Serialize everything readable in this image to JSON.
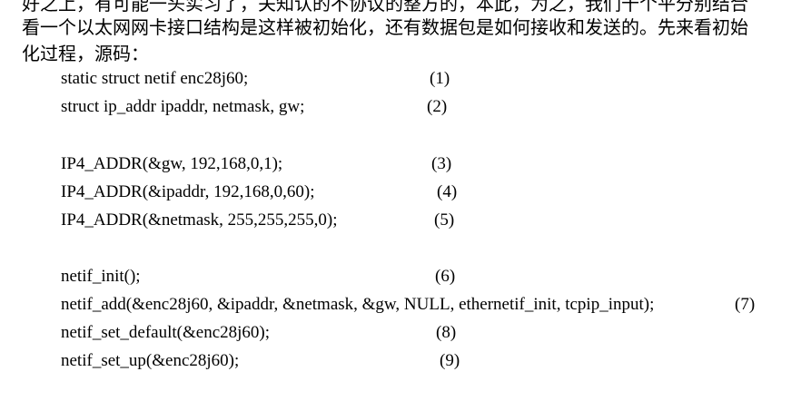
{
  "intro": {
    "cut_line": "好之上，有可能一头实习了，关知认的不协议的整方的，本此，为之，我们十个平分别结合",
    "line1": "看一个以太网网卡接口结构是这样被初始化，还有数据包是如何接收和发送的。先来看初始",
    "line2": "化过程，源码："
  },
  "code": [
    {
      "text": "static struct netif enc28j60;",
      "num": "(1)"
    },
    {
      "text": "struct ip_addr ipaddr, netmask, gw;",
      "num": "(2)"
    },
    {
      "text": "IP4_ADDR(&gw, 192,168,0,1);",
      "num": "(3)"
    },
    {
      "text": "IP4_ADDR(&ipaddr, 192,168,0,60);",
      "num": "(4)"
    },
    {
      "text": "IP4_ADDR(&netmask, 255,255,255,0);",
      "num": "(5)"
    },
    {
      "text": "netif_init();",
      "num": "(6)"
    },
    {
      "text": "netif_add(&enc28j60, &ipaddr, &netmask, &gw, NULL, ethernetif_init, tcpip_input);",
      "num": "(7)"
    },
    {
      "text": "netif_set_default(&enc28j60);",
      "num": "(8)"
    },
    {
      "text": "netif_set_up(&enc28j60);",
      "num": "(9)"
    }
  ]
}
